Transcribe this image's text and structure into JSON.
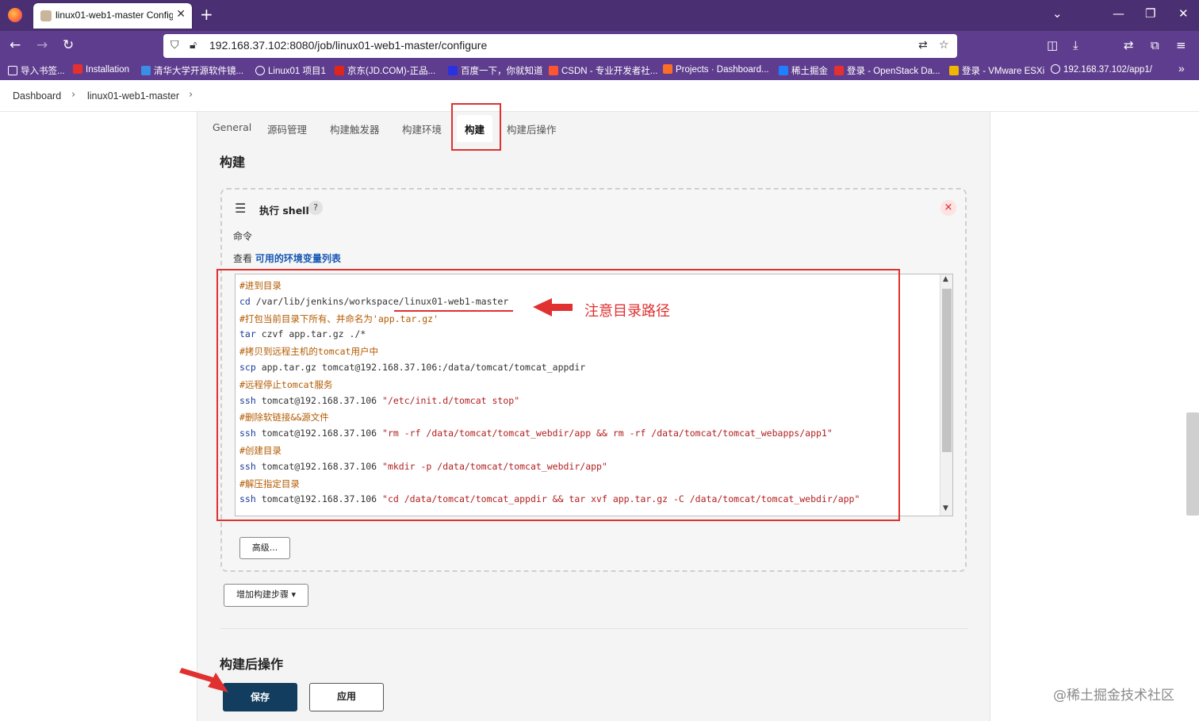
{
  "browser": {
    "tab_title": "linux01-web1-master Config",
    "url": "192.168.37.102:8080/job/linux01-web1-master/configure",
    "bookmarks": [
      {
        "label": "导入书签...",
        "color": "#ffffff"
      },
      {
        "label": "Installation",
        "color": "#e53030"
      },
      {
        "label": "清华大学开源软件镜...",
        "color": "#3a8ee6"
      },
      {
        "label": "Linux01 项目1",
        "color": "#ffffff"
      },
      {
        "label": "京东(JD.COM)-正品...",
        "color": "#e1251b"
      },
      {
        "label": "百度一下，你就知道",
        "color": "#2932e1"
      },
      {
        "label": "CSDN - 专业开发者社...",
        "color": "#fc5531"
      },
      {
        "label": "Projects · Dashboard...",
        "color": "#fc6d26"
      },
      {
        "label": "稀土掘金",
        "color": "#1e80ff"
      },
      {
        "label": "登录 - OpenStack Da...",
        "color": "#e53030"
      },
      {
        "label": "登录 - VMware ESXi",
        "color": "#f2b500"
      },
      {
        "label": "192.168.37.102/app1/",
        "color": "#ffffff"
      }
    ]
  },
  "breadcrumb": {
    "items": [
      "Dashboard",
      "linux01-web1-master"
    ]
  },
  "config_tabs": [
    "General",
    "源码管理",
    "构建触发器",
    "构建环境",
    "构建",
    "构建后操作"
  ],
  "active_tab": "构建",
  "build_section": {
    "title": "构建",
    "step": {
      "title": "执行 shell",
      "help": "?",
      "close": "×",
      "command_label": "命令",
      "env_prefix": "查看 ",
      "env_link": "可用的环境变量列表",
      "code_lines": [
        {
          "type": "comment",
          "text": "#进到目录"
        },
        {
          "type": "cmd",
          "cmd": "cd",
          "rest": " /var/lib/jenkins/workspace/linux01-web1-master"
        },
        {
          "type": "comment",
          "text": "#打包当前目录下所有、并命名为'app.tar.gz'"
        },
        {
          "type": "cmd",
          "cmd": "tar",
          "rest": " czvf app.tar.gz ./*"
        },
        {
          "type": "comment",
          "text": "#拷贝到远程主机的tomcat用户中"
        },
        {
          "type": "cmd",
          "cmd": "scp",
          "rest": " app.tar.gz tomcat@192.168.37.106:/data/tomcat/tomcat_appdir"
        },
        {
          "type": "comment",
          "text": "#远程停止tomcat服务"
        },
        {
          "type": "ssh",
          "cmd": "ssh",
          "rest": " tomcat@192.168.37.106 ",
          "str": "\"/etc/init.d/tomcat stop\""
        },
        {
          "type": "comment",
          "text": "#删除软链接&&源文件"
        },
        {
          "type": "ssh",
          "cmd": "ssh",
          "rest": " tomcat@192.168.37.106 ",
          "str": "\"rm -rf /data/tomcat/tomcat_webdir/app && rm -rf /data/tomcat/tomcat_webapps/app1\""
        },
        {
          "type": "comment",
          "text": "#创建目录"
        },
        {
          "type": "ssh",
          "cmd": "ssh",
          "rest": " tomcat@192.168.37.106 ",
          "str": "\"mkdir -p /data/tomcat/tomcat_webdir/app\""
        },
        {
          "type": "comment",
          "text": "#解压指定目录"
        },
        {
          "type": "ssh",
          "cmd": "ssh",
          "rest": " tomcat@192.168.37.106 ",
          "str": "\"cd /data/tomcat/tomcat_appdir && tar xvf app.tar.gz -C /data/tomcat/tomcat_webdir/app\""
        }
      ],
      "advanced_button": "高级..."
    },
    "add_step_button": "增加构建步骤 ▾"
  },
  "post_build_section": {
    "title": "构建后操作"
  },
  "actions": {
    "save": "保存",
    "apply": "应用"
  },
  "annotation": {
    "text": "注意目录路径",
    "color": "#e03030"
  },
  "watermark": "@稀土掘金技术社区"
}
